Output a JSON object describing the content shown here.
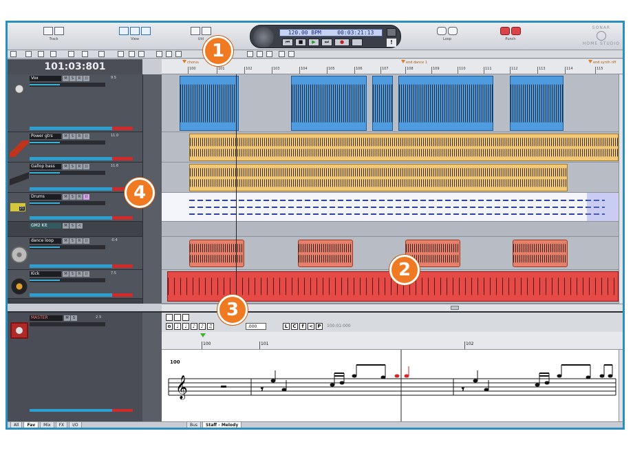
{
  "toolbar": {
    "track_label": "Track",
    "view_label": "View",
    "util_label": "Util",
    "loop_label": "Loop",
    "punch_label": "Punch"
  },
  "transport": {
    "tempo": "120.00 BPM",
    "time": "00:03:21:13"
  },
  "brand": {
    "top": "SONAR",
    "bottom": "HOME STUDIO"
  },
  "clock": "101:03:801",
  "ruler": {
    "measures": [
      "100",
      "101",
      "102",
      "103",
      "104",
      "105",
      "106",
      "107",
      "108",
      "109",
      "110",
      "111",
      "112",
      "113",
      "114",
      "115"
    ],
    "markers": [
      "chorus",
      "end dance 1",
      "end synth riff"
    ]
  },
  "tracks": [
    {
      "name": "Vox",
      "num": "9.5"
    },
    {
      "name": "Power gtrs",
      "num": "11.0"
    },
    {
      "name": "Gallop bass",
      "num": "11.6"
    },
    {
      "name": "Drums",
      "num": ""
    },
    {
      "name": "GM2 Kit",
      "num": ""
    },
    {
      "name": "dance loop",
      "num": "-0.4"
    },
    {
      "name": "Kick",
      "num": "7.5"
    }
  ],
  "drum_kit_number": "21",
  "master": {
    "name": "MASTER",
    "num": "2.3"
  },
  "view_tabs": [
    "All",
    "Fav",
    "Mix",
    "FX",
    "I/O"
  ],
  "active_view_tab": "Fav",
  "staff": {
    "duration_value": ".000",
    "position": "100:01:000",
    "measures": [
      "100",
      "101",
      "102"
    ],
    "tempo_marking": "100",
    "tabs": [
      "Bus",
      "Staff - Melody"
    ],
    "active_tab": "Staff - Melody"
  },
  "callouts": [
    "1",
    "2",
    "3",
    "4"
  ],
  "colors": {
    "frame": "#2a8fbf",
    "callout": "#f07a22",
    "vox_clip": "#4f9be0",
    "gtr_clip": "#f2c877",
    "loop_clip": "#e6806a",
    "kick_clip": "#e64a46"
  }
}
